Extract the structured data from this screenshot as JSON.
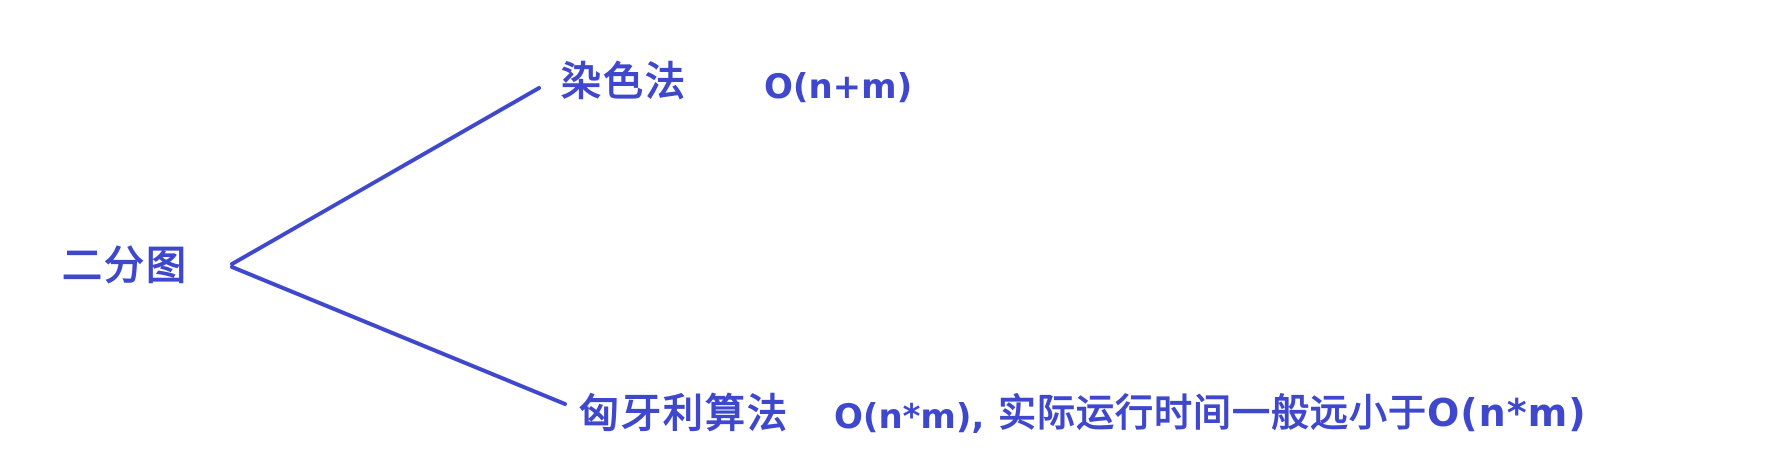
{
  "diagram": {
    "root": {
      "label": "二分图"
    },
    "branches": [
      {
        "method": "染色法",
        "complexity": "O(n+m)",
        "note": ""
      },
      {
        "method": "匈牙利算法",
        "complexity": "O(n*m),",
        "note": "实际运行时间一般远小于O(n*m)"
      }
    ]
  },
  "colors": {
    "ink": "#3f48cc"
  }
}
